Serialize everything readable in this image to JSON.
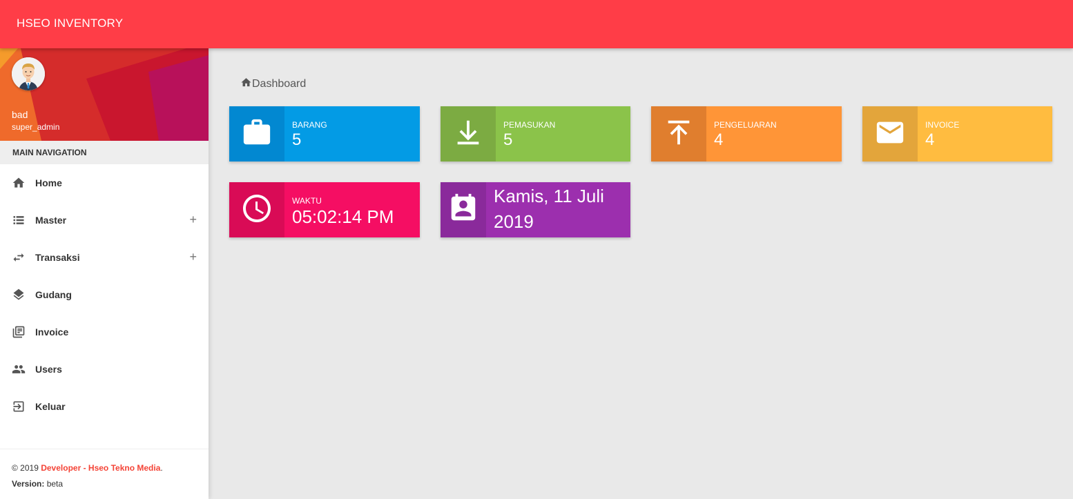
{
  "app": {
    "title": "HSEO INVENTORY"
  },
  "user": {
    "name": "bad",
    "role": "super_admin"
  },
  "sidebar": {
    "heading": "MAIN NAVIGATION",
    "items": [
      {
        "label": "Home",
        "icon": "home-icon",
        "expandable": false
      },
      {
        "label": "Master",
        "icon": "list-icon",
        "expandable": true
      },
      {
        "label": "Transaksi",
        "icon": "swap-icon",
        "expandable": true
      },
      {
        "label": "Gudang",
        "icon": "layers-icon",
        "expandable": false
      },
      {
        "label": "Invoice",
        "icon": "library-books-icon",
        "expandable": false
      },
      {
        "label": "Users",
        "icon": "people-icon",
        "expandable": false
      },
      {
        "label": "Keluar",
        "icon": "exit-icon",
        "expandable": false
      }
    ],
    "expand_symbol": "+"
  },
  "footer": {
    "copyright": "© 2019",
    "developer": "Developer - Hseo Tekno Media",
    "period": ".",
    "version_label": "Version:",
    "version": "beta"
  },
  "breadcrumb": {
    "label": "Dashboard"
  },
  "cards": {
    "barang": {
      "label": "BARANG",
      "value": "5",
      "icon": "briefcase-icon",
      "color": "#039be5",
      "icon_bg": "#0288d1"
    },
    "pemasukan": {
      "label": "PEMASUKAN",
      "value": "5",
      "icon": "download-icon",
      "color": "#8bc34a",
      "icon_bg": "#7cab42"
    },
    "pengeluaran": {
      "label": "PENGELUARAN",
      "value": "4",
      "icon": "upload-icon",
      "color": "#ff9537",
      "icon_bg": "#e07e2e"
    },
    "invoice": {
      "label": "INVOICE",
      "value": "4",
      "icon": "mail-icon",
      "color": "#ffbc40",
      "icon_bg": "#e3a53b"
    },
    "waktu": {
      "label": "WAKTU",
      "value": "05:02:14 PM",
      "icon": "clock-icon",
      "color": "#f50e63",
      "icon_bg": "#d90b56"
    },
    "tanggal": {
      "value": "Kamis, 11 Juli 2019",
      "icon": "contact-calendar-icon",
      "color": "#9c2fae",
      "icon_bg": "#8a2a9b"
    }
  },
  "colors": {
    "topbar": "#ff3d47",
    "accent": "#f44336",
    "background": "#e9e9e9"
  }
}
